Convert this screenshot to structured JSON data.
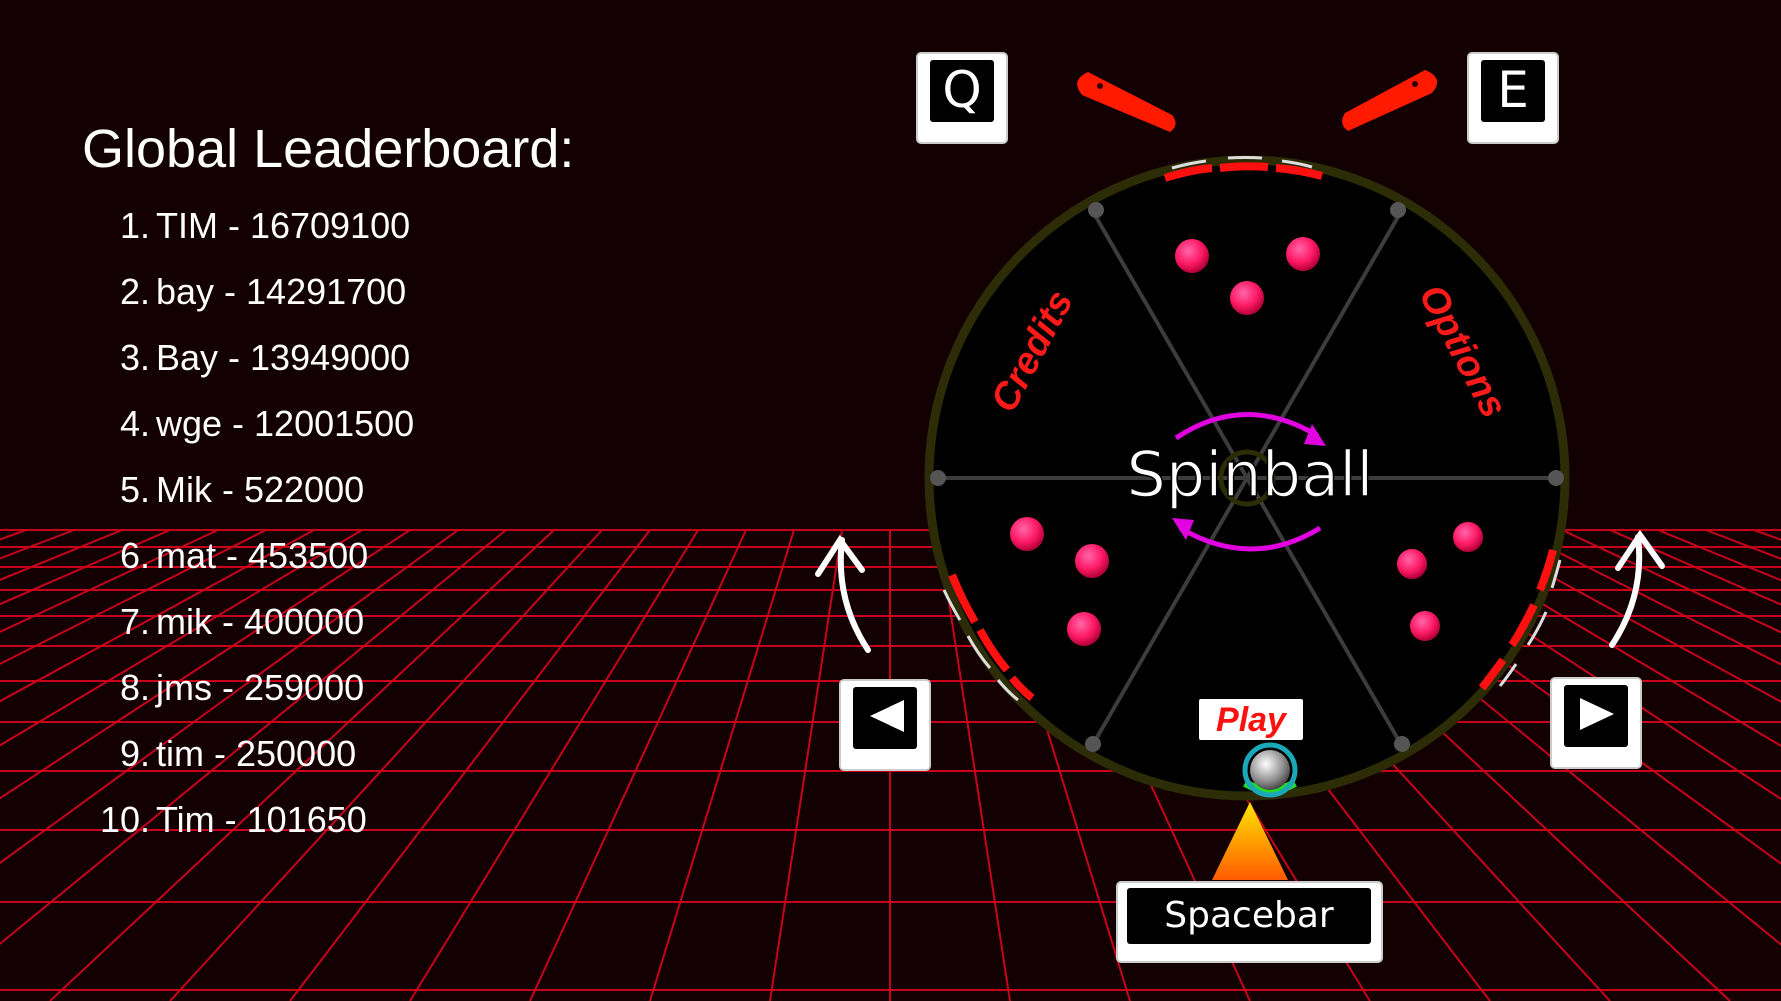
{
  "leaderboard": {
    "title": "Global Leaderboard:",
    "entries": [
      {
        "rank": "1.",
        "text": "TIM - 16709100"
      },
      {
        "rank": "2.",
        "text": "bay - 14291700"
      },
      {
        "rank": "3.",
        "text": "Bay - 13949000"
      },
      {
        "rank": "4.",
        "text": "wge - 12001500"
      },
      {
        "rank": "5.",
        "text": "Mik - 522000"
      },
      {
        "rank": "6.",
        "text": "mat - 453500"
      },
      {
        "rank": "7.",
        "text": "mik - 400000"
      },
      {
        "rank": "8.",
        "text": "jms - 259000"
      },
      {
        "rank": "9.",
        "text": "tim - 250000"
      },
      {
        "rank": "10.",
        "text": "Tim - 101650"
      }
    ]
  },
  "wheel": {
    "logo": "Spinball",
    "credits_label": "Credits",
    "options_label": "Options",
    "play_label": "Play"
  },
  "keys": {
    "q": "Q",
    "e": "E",
    "left_icon": "left-triangle-icon",
    "right_icon": "right-triangle-icon",
    "spacebar": "Spacebar"
  },
  "colors": {
    "background": "#120002",
    "grid": "#c8001a",
    "accent_red": "#ff1a1a",
    "bumper": "#ff1a66",
    "logo_arrows": "#e000e0",
    "wheel_rim": "#2c2c06",
    "text": "#ffffff"
  }
}
